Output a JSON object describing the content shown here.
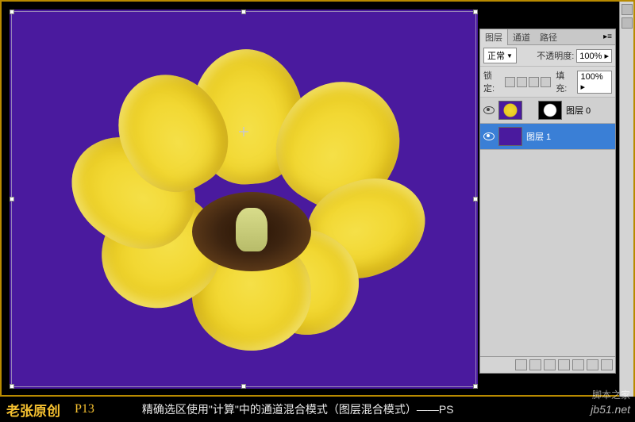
{
  "canvas": {
    "bg_color": "#4a1a9e",
    "subject": "yellow-tulip-flower"
  },
  "panel": {
    "tabs": [
      "图层",
      "通道",
      "路径"
    ],
    "active_tab": 0,
    "blend_mode": "正常",
    "opacity_label": "不透明度:",
    "opacity_value": "100%",
    "lock_label": "锁定:",
    "fill_label": "填充:",
    "fill_value": "100%",
    "layers": [
      {
        "name": "图层 0",
        "visible": true,
        "selected": false,
        "has_mask": true
      },
      {
        "name": "图层 1",
        "visible": true,
        "selected": true,
        "has_mask": false
      }
    ]
  },
  "footer": {
    "credit": "老张原创",
    "page": "P13",
    "subtitle": "精确选区使用\"计算\"中的通道混合模式（图层混合模式）——PS",
    "watermark_top": "脚本之家",
    "watermark": "jb51.net"
  }
}
